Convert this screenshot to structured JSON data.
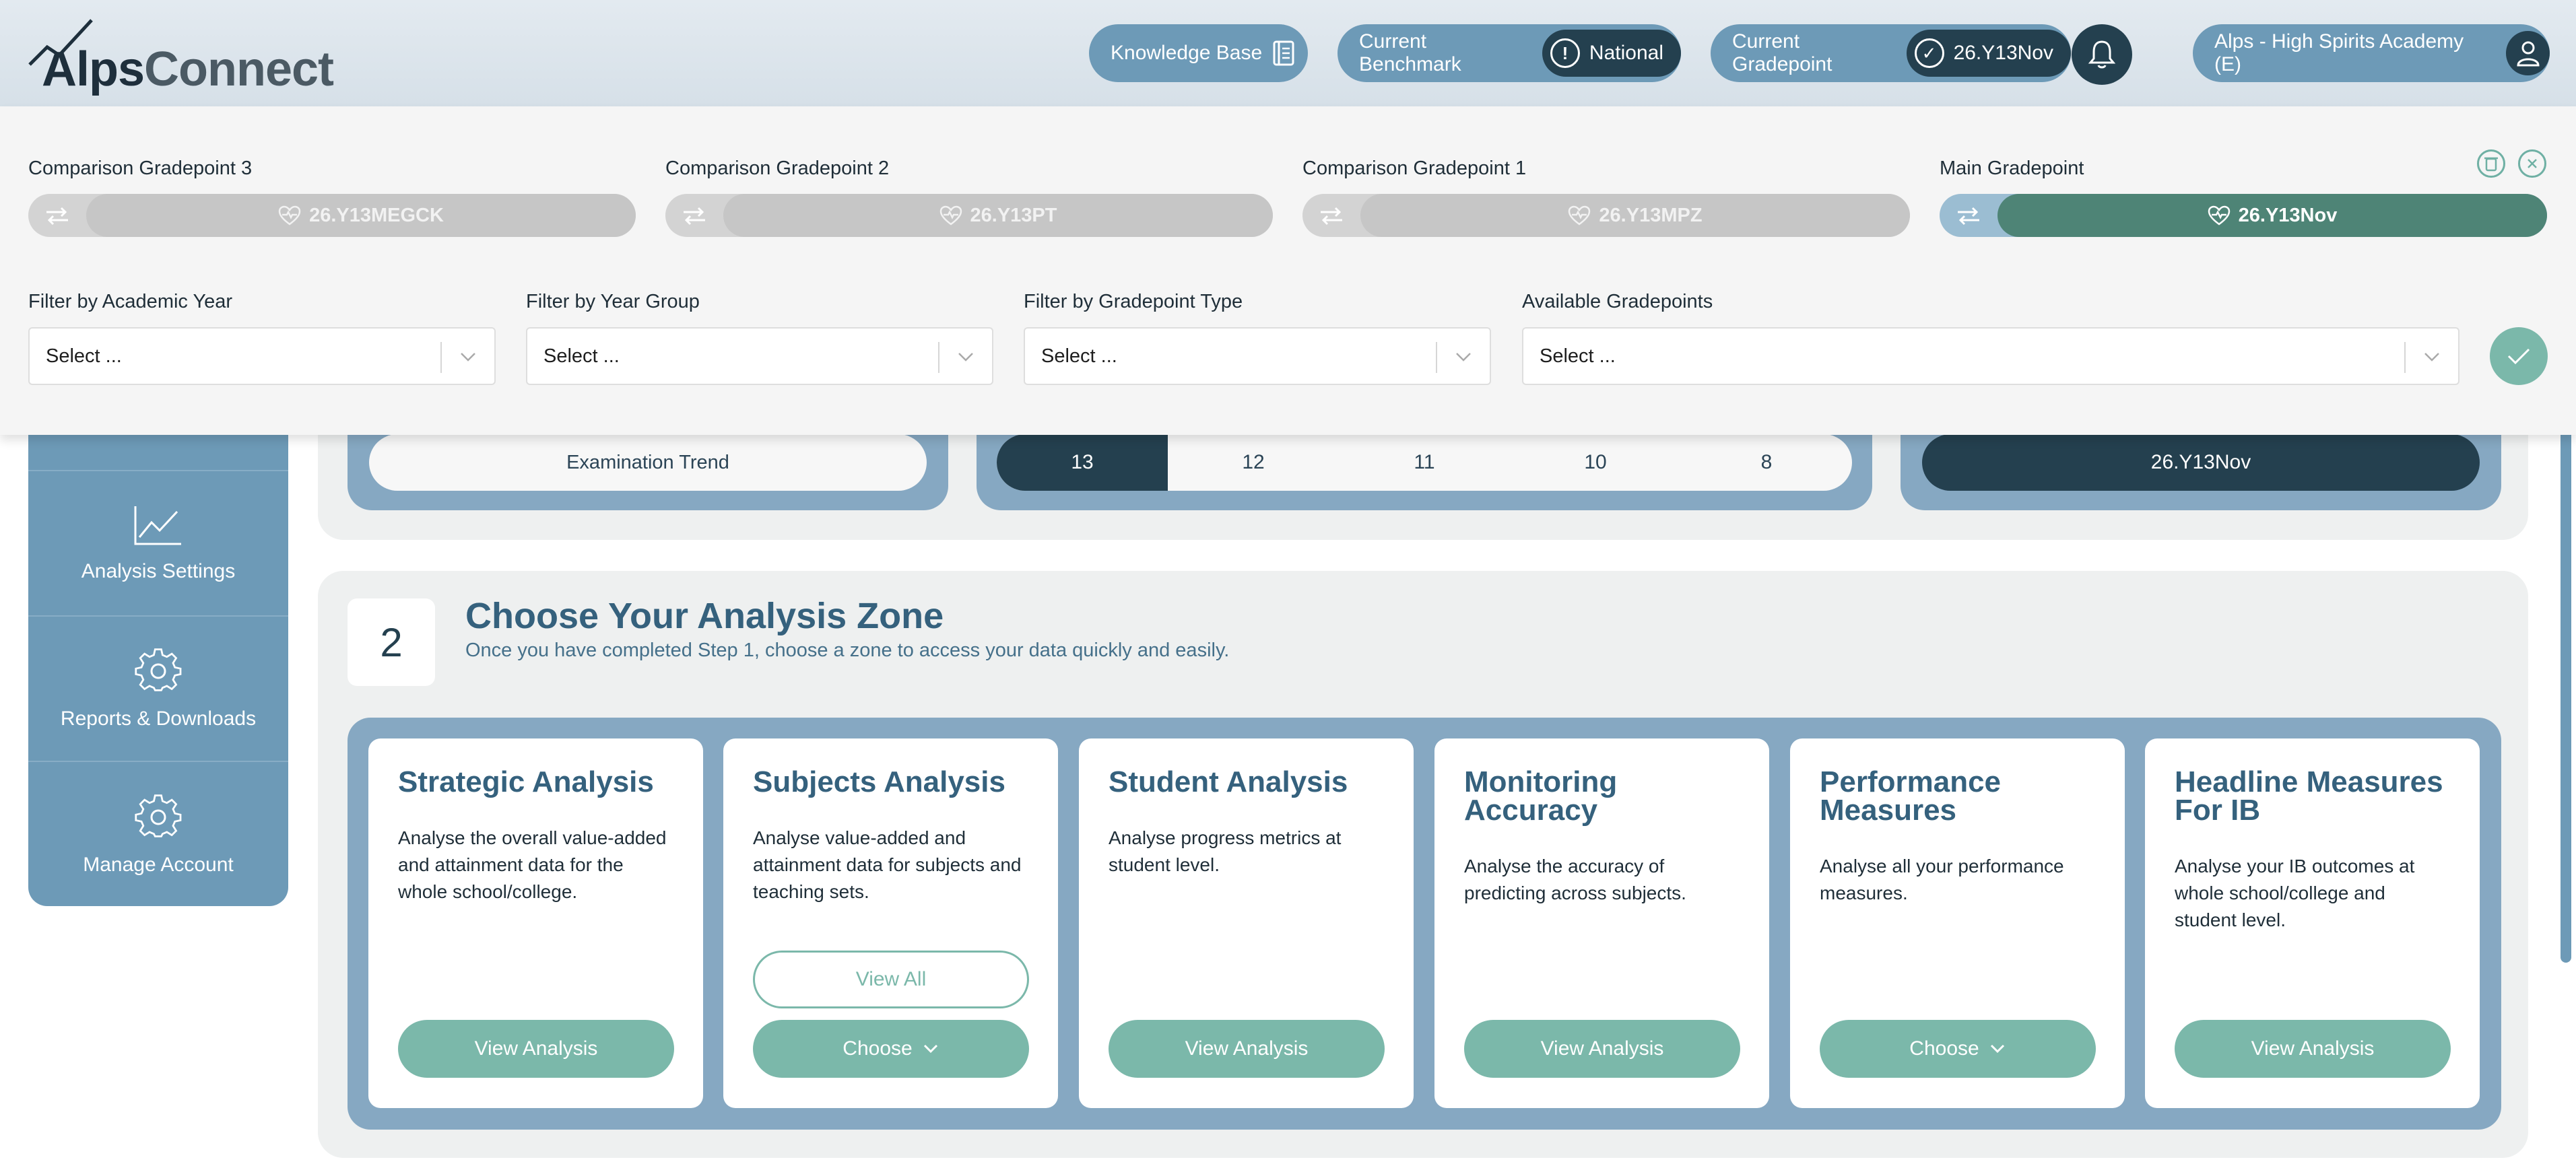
{
  "brand": {
    "logo_part1": "Alps",
    "logo_part2": "Connect"
  },
  "header": {
    "knowledge_base_label": "Knowledge Base",
    "benchmark_label": "Current Benchmark",
    "benchmark_value": "National",
    "gradepoint_label": "Current Gradepoint",
    "gradepoint_value": "26.Y13Nov",
    "account_label": "Alps - High Spirits Academy (E)"
  },
  "gradepoint_panel": {
    "comparison3": {
      "label": "Comparison Gradepoint 3",
      "value": "26.Y13MEGCK"
    },
    "comparison2": {
      "label": "Comparison Gradepoint 2",
      "value": "26.Y13PT"
    },
    "comparison1": {
      "label": "Comparison Gradepoint 1",
      "value": "26.Y13MPZ"
    },
    "main": {
      "label": "Main Gradepoint",
      "value": "26.Y13Nov"
    }
  },
  "filters": {
    "academic_year": {
      "label": "Filter by Academic Year",
      "value": "Select ..."
    },
    "year_group": {
      "label": "Filter by Year Group",
      "value": "Select ..."
    },
    "gradepoint_type": {
      "label": "Filter by Gradepoint Type",
      "value": "Select ..."
    },
    "available": {
      "label": "Available Gradepoints",
      "value": "Select ..."
    }
  },
  "sidebar": {
    "items": [
      {
        "label": "Analysis Settings",
        "icon": "line-chart-icon"
      },
      {
        "label": "Reports & Downloads",
        "icon": "gear-icon"
      },
      {
        "label": "Manage Account",
        "icon": "gear-icon"
      }
    ]
  },
  "step1": {
    "trend_button": "Examination Trend",
    "years": [
      "13",
      "12",
      "11",
      "10",
      "8"
    ],
    "active_year": "13",
    "current_gradepoint": "26.Y13Nov"
  },
  "step2": {
    "number": "2",
    "title": "Choose Your Analysis Zone",
    "subtitle": "Once you have completed Step 1, choose a zone to access your data quickly and easily.",
    "cards": [
      {
        "title": "Strategic Analysis",
        "desc": "Analyse the overall value-added and attainment data for the whole school/college.",
        "button": "View Analysis"
      },
      {
        "title": "Subjects Analysis",
        "desc": "Analyse value-added and attainment data for subjects and teaching sets.",
        "secondary_button": "View All",
        "button": "Choose"
      },
      {
        "title": "Student Analysis",
        "desc": "Analyse progress metrics at student level.",
        "button": "View Analysis"
      },
      {
        "title": "Monitoring Accuracy",
        "desc": "Analyse the accuracy of predicting across subjects.",
        "button": "View Analysis"
      },
      {
        "title": "Performance Measures",
        "desc": "Analyse all your performance measures.",
        "button": "Choose"
      },
      {
        "title": "Headline Measures For IB",
        "desc": "Analyse your IB outcomes at whole school/college and student level.",
        "button": "View Analysis"
      }
    ]
  },
  "colors": {
    "accent_blue": "#6d9ab7",
    "dark_navy": "#24404f",
    "teal": "#7bb8aa",
    "main_gp_green": "#4e8476"
  }
}
